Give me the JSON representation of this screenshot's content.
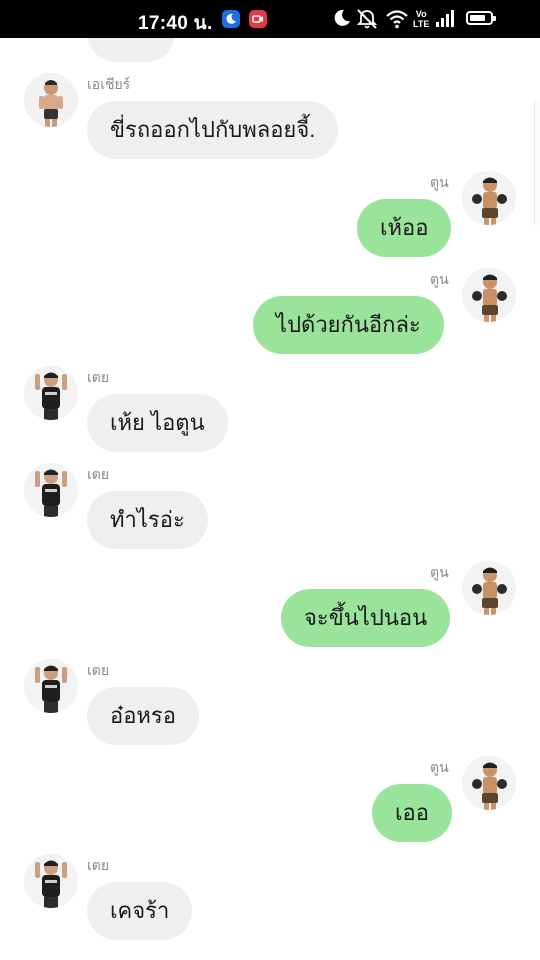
{
  "status_bar": {
    "time": "17:40 น.",
    "volte_line1": "Vo",
    "volte_line2": "LTE",
    "battery_level": 0.8
  },
  "chat": {
    "messages": [
      {
        "sender": "",
        "direction": "in",
        "text": ""
      },
      {
        "sender": "เอเชียร์",
        "direction": "in",
        "text": "ขี่รถออกไปกับพลอยจี้."
      },
      {
        "sender": "ตูน",
        "direction": "out",
        "text": "เห้ออ"
      },
      {
        "sender": "ตูน",
        "direction": "out",
        "text": "ไปด้วยกันอีกล่ะ"
      },
      {
        "sender": "เตย",
        "direction": "in",
        "text": "เห้ย ไอตูน"
      },
      {
        "sender": "เตย",
        "direction": "in",
        "text": "ทำไรอ่ะ"
      },
      {
        "sender": "ตูน",
        "direction": "out",
        "text": "จะขึ้นไปนอน"
      },
      {
        "sender": "เตย",
        "direction": "in",
        "text": "อ๋อหรอ"
      },
      {
        "sender": "ตูน",
        "direction": "out",
        "text": "เออ"
      },
      {
        "sender": "เตย",
        "direction": "in",
        "text": "เคจร้า"
      }
    ]
  },
  "colors": {
    "incoming_bubble": "#efefef",
    "outgoing_bubble": "#99e39a",
    "status_bar": "#000000"
  }
}
